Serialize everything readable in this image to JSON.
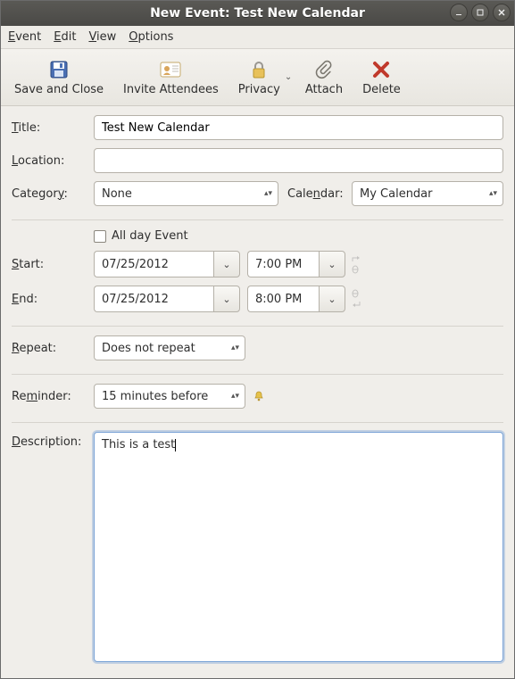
{
  "window": {
    "title": "New Event: Test New Calendar"
  },
  "menu": {
    "event": "Event",
    "edit": "Edit",
    "view": "View",
    "options": "Options"
  },
  "toolbar": {
    "save_label": "Save and Close",
    "invite_label": "Invite Attendees",
    "privacy_label": "Privacy",
    "attach_label": "Attach",
    "delete_label": "Delete"
  },
  "labels": {
    "title": "Title:",
    "location": "Location:",
    "category": "Category:",
    "calendar": "Calendar:",
    "all_day": "All day Event",
    "start": "Start:",
    "end": "End:",
    "repeat": "Repeat:",
    "reminder": "Reminder:",
    "description": "Description:"
  },
  "fields": {
    "title_value": "Test New Calendar",
    "location_value": "",
    "category_value": "None",
    "calendar_value": "My Calendar",
    "all_day_checked": false,
    "start_date": "07/25/2012",
    "start_time": "7:00 PM",
    "end_date": "07/25/2012",
    "end_time": "8:00 PM",
    "repeat_value": "Does not repeat",
    "reminder_value": "15 minutes before",
    "description_value": "This is a test"
  }
}
